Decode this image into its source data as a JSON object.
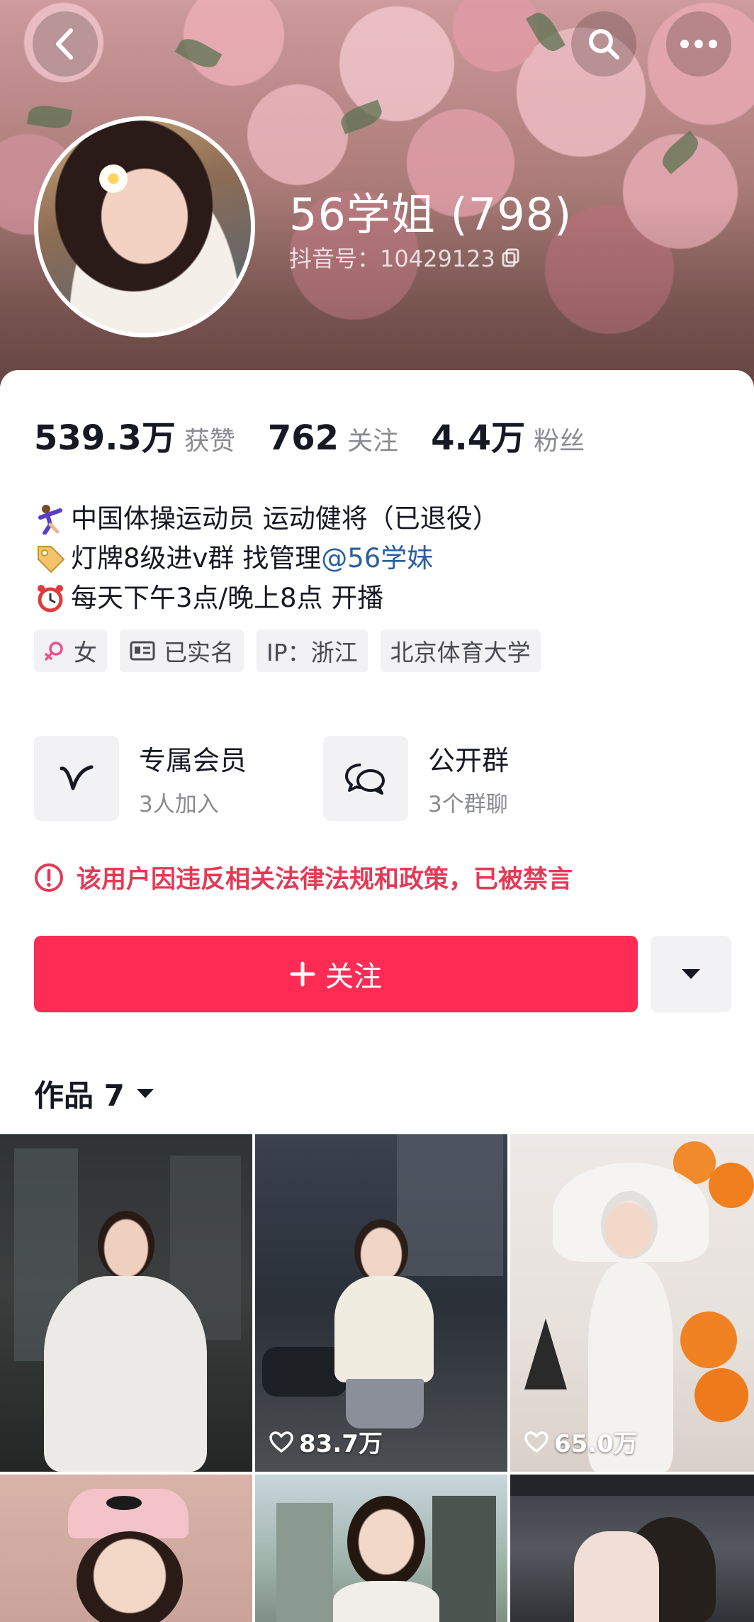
{
  "header": {
    "nickname": "56学姐 (798)",
    "douyin_id": "抖音号：10429123",
    "icons": [
      "back-icon",
      "search-icon",
      "more-icon"
    ]
  },
  "stats": [
    {
      "value": "539.3万",
      "label": "获赞"
    },
    {
      "value": "762",
      "label": "关注"
    },
    {
      "value": "4.4万",
      "label": "粉丝"
    }
  ],
  "bio": {
    "line1": "中国体操运动员 运动健将（已退役）",
    "line2_prefix": "灯牌8级进v群 找管理",
    "line2_mention": "@56学妹",
    "line3": "每天下午3点/晚上8点 开播"
  },
  "tags": {
    "gender": "女",
    "verified": "已实名",
    "ip": "IP：浙江",
    "school": "北京体育大学"
  },
  "groups": [
    {
      "title": "专属会员",
      "subtitle": "3人加入",
      "icon": "vip-v-icon"
    },
    {
      "title": "公开群",
      "subtitle": "3个群聊",
      "icon": "group-chat-icon"
    }
  ],
  "warning": "该用户因违反相关法律法规和政策，已被禁言",
  "follow_button": "关注",
  "works_tab": "作品 7",
  "videos": [
    {
      "likes": ""
    },
    {
      "likes": "83.7万"
    },
    {
      "likes": "65.0万"
    },
    {
      "likes": ""
    },
    {
      "likes": ""
    },
    {
      "likes": ""
    }
  ],
  "colors": {
    "accent": "#fe2c55",
    "warning": "#e43a56",
    "mention": "#2b5f9e"
  }
}
